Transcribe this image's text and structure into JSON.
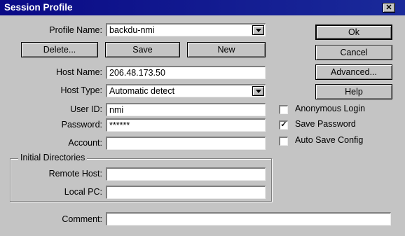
{
  "window": {
    "title": "Session Profile"
  },
  "profile": {
    "label": "Profile Name:",
    "value": "backdu-nmi"
  },
  "actions": {
    "delete": "Delete...",
    "save": "Save",
    "new": "New"
  },
  "side_buttons": {
    "ok": "Ok",
    "cancel": "Cancel",
    "advanced": "Advanced...",
    "help": "Help"
  },
  "fields": {
    "host_name": {
      "label": "Host Name:",
      "value": "206.48.173.50"
    },
    "host_type": {
      "label": "Host Type:",
      "value": "Automatic detect"
    },
    "user_id": {
      "label": "User ID:",
      "value": "nmi"
    },
    "password": {
      "label": "Password:",
      "value": "******"
    },
    "account": {
      "label": "Account:",
      "value": ""
    }
  },
  "checkboxes": {
    "anonymous": {
      "label": "Anonymous Login",
      "checked": false
    },
    "save_password": {
      "label": "Save Password",
      "checked": true
    },
    "auto_save": {
      "label": "Auto Save Config",
      "checked": false
    }
  },
  "initial_dirs": {
    "title": "Initial Directories",
    "remote_host": {
      "label": "Remote Host:",
      "value": ""
    },
    "local_pc": {
      "label": "Local PC:",
      "value": ""
    }
  },
  "comment": {
    "label": "Comment:",
    "value": ""
  },
  "check_mark": "✓"
}
